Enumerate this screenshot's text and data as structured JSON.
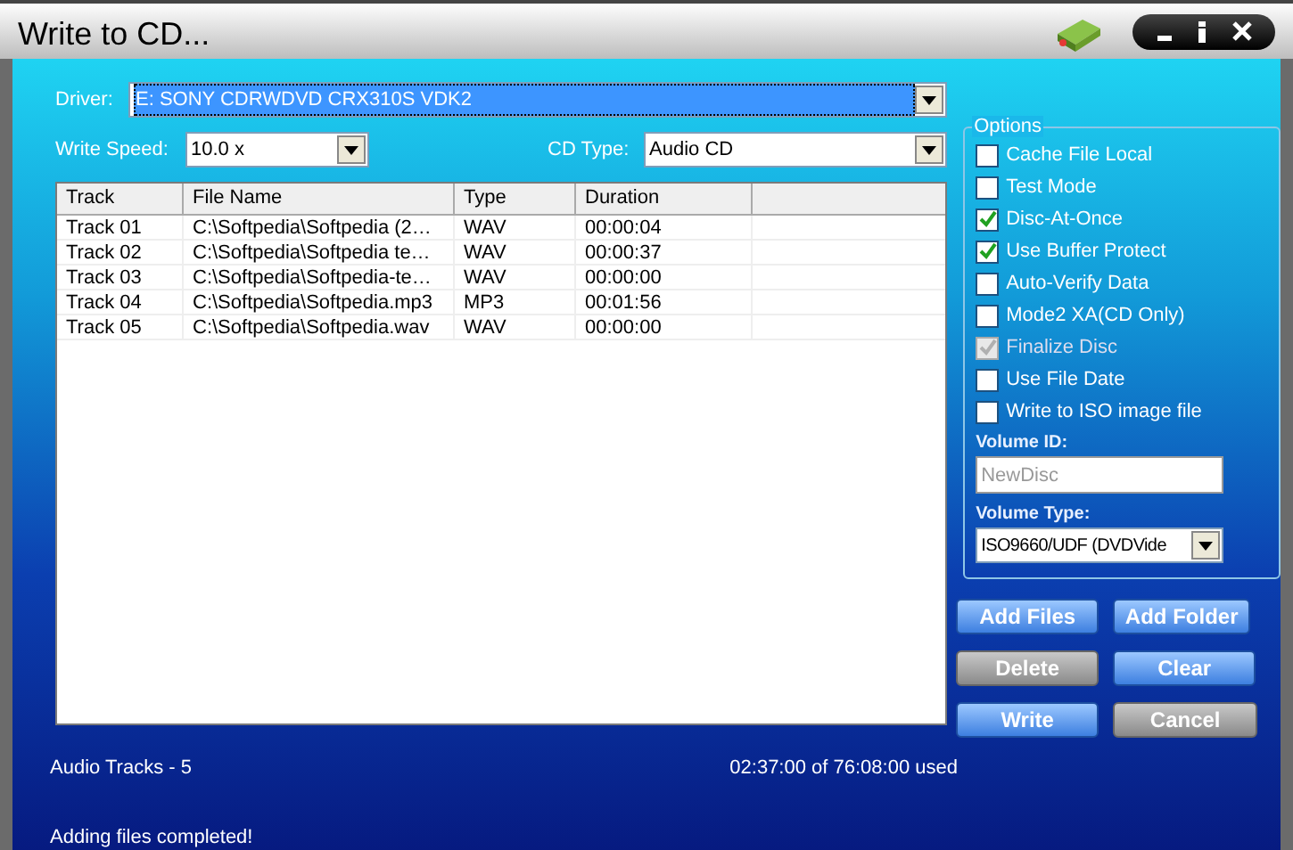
{
  "window": {
    "title": "Write to CD..."
  },
  "driver": {
    "label": "Driver:",
    "value": "E: SONY CDRWDVD CRX310S VDK2"
  },
  "write_speed": {
    "label": "Write Speed:",
    "value": "10.0 x"
  },
  "cd_type": {
    "label": "CD Type:",
    "value": "Audio CD"
  },
  "table": {
    "columns": [
      "Track",
      "File Name",
      "Type",
      "Duration"
    ],
    "rows": [
      [
        "Track 01",
        "C:\\Softpedia\\Softpedia (2…",
        "WAV",
        "00:00:04"
      ],
      [
        "Track 02",
        "C:\\Softpedia\\Softpedia te…",
        "WAV",
        "00:00:37"
      ],
      [
        "Track 03",
        "C:\\Softpedia\\Softpedia-te…",
        "WAV",
        "00:00:00"
      ],
      [
        "Track 04",
        "C:\\Softpedia\\Softpedia.mp3",
        "MP3",
        "00:01:56"
      ],
      [
        "Track 05",
        "C:\\Softpedia\\Softpedia.wav",
        "WAV",
        "00:00:00"
      ]
    ]
  },
  "options": {
    "title": "Options",
    "items": [
      {
        "label": "Cache File Local",
        "checked": false,
        "disabled": false
      },
      {
        "label": "Test Mode",
        "checked": false,
        "disabled": false
      },
      {
        "label": "Disc-At-Once",
        "checked": true,
        "disabled": false
      },
      {
        "label": "Use Buffer Protect",
        "checked": true,
        "disabled": false
      },
      {
        "label": "Auto-Verify Data",
        "checked": false,
        "disabled": false
      },
      {
        "label": "Mode2 XA(CD Only)",
        "checked": false,
        "disabled": false
      },
      {
        "label": "Finalize Disc",
        "checked": true,
        "disabled": true
      },
      {
        "label": "Use File Date",
        "checked": false,
        "disabled": false
      },
      {
        "label": "Write to ISO image file",
        "checked": false,
        "disabled": false
      }
    ],
    "volume_id": {
      "label": "Volume ID:",
      "placeholder": "NewDisc"
    },
    "volume_type": {
      "label": "Volume Type:",
      "value": "ISO9660/UDF (DVDVide"
    }
  },
  "buttons": [
    {
      "label": "Add Files",
      "disabled": false
    },
    {
      "label": "Add Folder",
      "disabled": false
    },
    {
      "label": "Delete",
      "disabled": true
    },
    {
      "label": "Clear",
      "disabled": false
    },
    {
      "label": "Write",
      "disabled": false
    },
    {
      "label": "Cancel",
      "disabled": true
    }
  ],
  "summary": {
    "tracks": "Audio Tracks - 5",
    "used": "02:37:00 of 76:08:00 used"
  },
  "status": "Adding files completed!"
}
